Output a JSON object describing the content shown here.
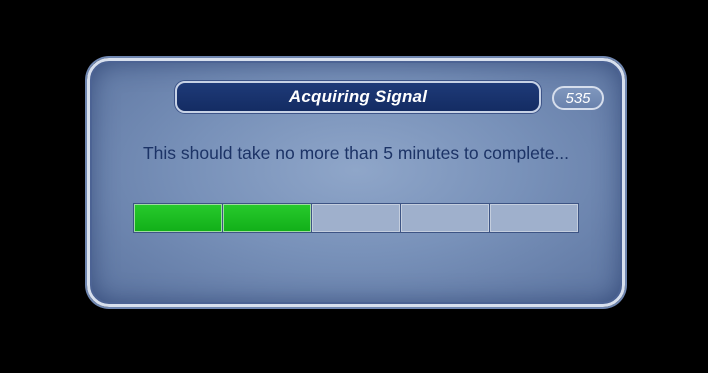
{
  "dialog": {
    "title": "Acquiring Signal",
    "counter": "535",
    "message": "This should take no more than 5 minutes to complete...",
    "progress": {
      "total_segments": 5,
      "filled_segments": 2,
      "fill_color": "#1fbf25",
      "empty_color": "#9fb0cc"
    }
  },
  "colors": {
    "title_bar": "#142c63",
    "dialog_body": "#7891b9",
    "text": "#1c3366"
  }
}
